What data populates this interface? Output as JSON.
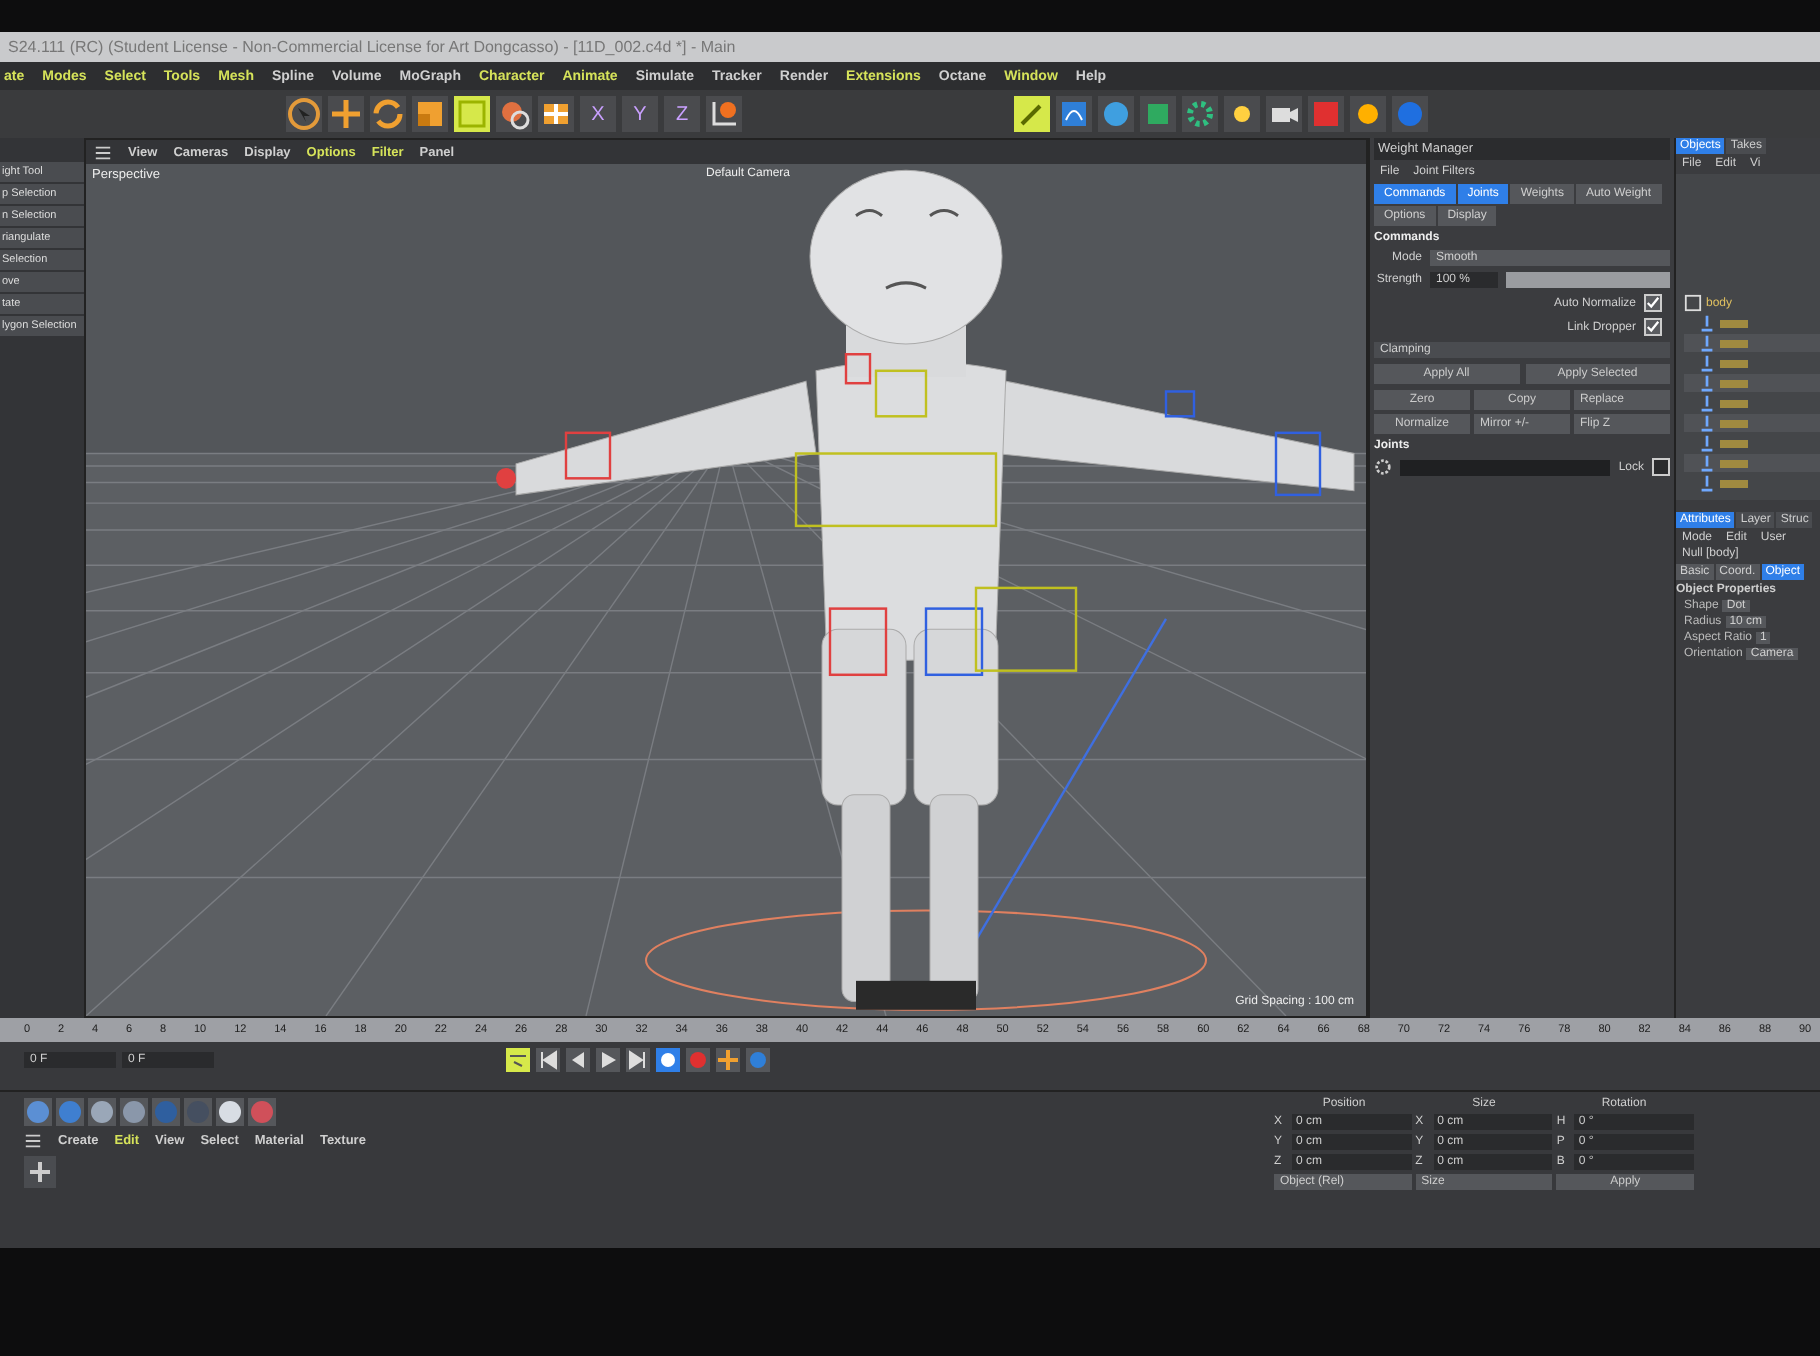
{
  "title_bar": {
    "title": "S24.111 (RC) (Student License - Non-Commercial License for Art Dongcasso) - [11D_002.c4d *] - Main"
  },
  "menu_bar": [
    {
      "label": "ate",
      "highlighted": true
    },
    {
      "label": "Modes",
      "highlighted": true
    },
    {
      "label": "Select",
      "highlighted": true
    },
    {
      "label": "Tools",
      "highlighted": true
    },
    {
      "label": "Mesh",
      "highlighted": true
    },
    {
      "label": "Spline",
      "highlighted": false
    },
    {
      "label": "Volume",
      "highlighted": false
    },
    {
      "label": "MoGraph",
      "highlighted": false
    },
    {
      "label": "Character",
      "highlighted": true
    },
    {
      "label": "Animate",
      "highlighted": true
    },
    {
      "label": "Simulate",
      "highlighted": false
    },
    {
      "label": "Tracker",
      "highlighted": false
    },
    {
      "label": "Render",
      "highlighted": false
    },
    {
      "label": "Extensions",
      "highlighted": true
    },
    {
      "label": "Octane",
      "highlighted": false
    },
    {
      "label": "Window",
      "highlighted": true
    },
    {
      "label": "Help",
      "highlighted": false
    }
  ],
  "toolbar": {
    "axis_buttons": [
      "X",
      "Y",
      "Z"
    ]
  },
  "tool_list": [
    "ight Tool",
    "p Selection",
    "n Selection",
    "riangulate",
    "Selection",
    "ove",
    "tate",
    "lygon Selection"
  ],
  "viewport": {
    "menu": [
      {
        "label": "View",
        "highlighted": false
      },
      {
        "label": "Cameras",
        "highlighted": false
      },
      {
        "label": "Display",
        "highlighted": false
      },
      {
        "label": "Options",
        "highlighted": true
      },
      {
        "label": "Filter",
        "highlighted": true
      },
      {
        "label": "Panel",
        "highlighted": false
      }
    ],
    "label": "Perspective",
    "camera": "Default Camera",
    "grid_spacing": "Grid Spacing : 100 cm"
  },
  "weight_manager": {
    "title": "Weight Manager",
    "menu": [
      "File",
      "Joint Filters"
    ],
    "tabs": [
      {
        "label": "Commands",
        "selected": true
      },
      {
        "label": "Joints",
        "selected": true
      },
      {
        "label": "Weights",
        "selected": false
      },
      {
        "label": "Auto Weight",
        "selected": false
      },
      {
        "label": "Options",
        "selected": false
      },
      {
        "label": "Display",
        "selected": false
      }
    ],
    "section": "Commands",
    "mode_label": "Mode",
    "mode": "Smooth",
    "strength_label": "Strength",
    "strength": "100 %",
    "strength_slider": {
      "level": 1
    },
    "toggles": [
      {
        "label": "Auto Normalize",
        "checked": true
      },
      {
        "label": "Link Dropper",
        "checked": true
      }
    ],
    "clamping": "Clamping",
    "apply_buttons": [
      "Apply All",
      "Apply Selected"
    ],
    "buttons": [
      {
        "label": "Zero",
        "kind": "button"
      },
      {
        "label": "Copy",
        "kind": "button"
      },
      {
        "label": "Replace",
        "kind": "dropdown"
      },
      {
        "label": "Normalize",
        "kind": "button"
      },
      {
        "label": "Mirror +/-",
        "kind": "dropdown"
      },
      {
        "label": "Flip Z",
        "kind": "dropdown"
      }
    ],
    "joints_label": "Joints",
    "lock": {
      "label": "Lock",
      "checked": false
    }
  },
  "object_manager": {
    "tabs": [
      {
        "label": "Objects",
        "selected": true
      },
      {
        "label": "Takes",
        "selected": false
      }
    ],
    "menu": [
      "File",
      "Edit",
      "Vi"
    ],
    "root": "body"
  },
  "attributes": {
    "tabs": [
      {
        "label": "Attributes",
        "selected": true
      },
      {
        "label": "Layer",
        "selected": false
      },
      {
        "label": "Struc",
        "selected": false
      }
    ],
    "menu": [
      "Mode",
      "Edit",
      "User"
    ],
    "object": "Null [body]",
    "sub_tabs": [
      {
        "label": "Basic",
        "selected": false
      },
      {
        "label": "Coord.",
        "selected": false
      },
      {
        "label": "Object",
        "selected": true
      }
    ],
    "section": "Object Properties",
    "fields": [
      {
        "label": "Shape",
        "value": "Dot"
      },
      {
        "label": "Radius",
        "value": "10 cm"
      },
      {
        "label": "Aspect Ratio",
        "value": "1"
      },
      {
        "label": "Orientation",
        "value": "Camera"
      }
    ]
  },
  "timeline": {
    "ticks": [
      "0",
      "2",
      "4",
      "6",
      "8",
      "10",
      "12",
      "14",
      "16",
      "18",
      "20",
      "22",
      "24",
      "26",
      "28",
      "30",
      "32",
      "34",
      "36",
      "38",
      "40",
      "42",
      "44",
      "46",
      "48",
      "50",
      "52",
      "54",
      "56",
      "58",
      "60",
      "62",
      "64",
      "66",
      "68",
      "70",
      "72",
      "74",
      "76",
      "78",
      "80",
      "82",
      "84",
      "86",
      "88",
      "90"
    ],
    "frame_fields": [
      "0 F",
      "0 F"
    ]
  },
  "material_manager": {
    "menu": [
      {
        "label": "Create",
        "highlighted": false
      },
      {
        "label": "Edit",
        "highlighted": true
      },
      {
        "label": "View",
        "highlighted": false
      },
      {
        "label": "Select",
        "highlighted": false
      },
      {
        "label": "Material",
        "highlighted": false
      },
      {
        "label": "Texture",
        "highlighted": false
      }
    ]
  },
  "coordinates": {
    "headers": [
      "Position",
      "Size",
      "Rotation"
    ],
    "rows": [
      {
        "axis": "X",
        "position": "0 cm",
        "size_axis": "X",
        "size": "0 cm",
        "rot_axis": "H",
        "rotation": "0 °"
      },
      {
        "axis": "Y",
        "position": "0 cm",
        "size_axis": "Y",
        "size": "0 cm",
        "rot_axis": "P",
        "rotation": "0 °"
      },
      {
        "axis": "Z",
        "position": "0 cm",
        "size_axis": "Z",
        "size": "0 cm",
        "rot_axis": "B",
        "rotation": "0 °"
      }
    ],
    "mode": "Object (Rel)",
    "size_mode": "Size",
    "apply": "Apply"
  }
}
